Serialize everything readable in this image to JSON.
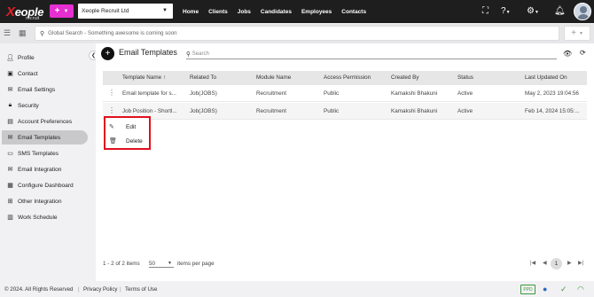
{
  "brand": {
    "logo_main": "Xeople",
    "logo_sub": "recruit",
    "color": "#e21f26"
  },
  "header": {
    "add_button": "+",
    "company": "Xeople Recruit Ltd",
    "nav": [
      "Home",
      "Clients",
      "Jobs",
      "Candidates",
      "Employees",
      "Contacts"
    ],
    "icons": [
      "fullscreen-icon",
      "help-icon",
      "settings-icon",
      "bell-icon",
      "avatar"
    ]
  },
  "search": {
    "placeholder": "Global Search - Something awesome is coming soon",
    "add_label": "+"
  },
  "sidebar": {
    "items": [
      {
        "label": "Profile",
        "icon": "person-icon"
      },
      {
        "label": "Contact",
        "icon": "contact-card-icon"
      },
      {
        "label": "Email Settings",
        "icon": "email-icon"
      },
      {
        "label": "Security",
        "icon": "lock-icon"
      },
      {
        "label": "Account Preferences",
        "icon": "account-icon"
      },
      {
        "label": "Email Templates",
        "icon": "email-open-icon",
        "active": true
      },
      {
        "label": "SMS Templates",
        "icon": "sms-icon"
      },
      {
        "label": "Email Integration",
        "icon": "email-integration-icon"
      },
      {
        "label": "Configure Dashboard",
        "icon": "dashboard-icon"
      },
      {
        "label": "Other Integration",
        "icon": "integration-icon"
      },
      {
        "label": "Work Schedule",
        "icon": "calendar-icon"
      }
    ]
  },
  "page": {
    "title": "Email Templates",
    "search_placeholder": "Search"
  },
  "table": {
    "columns": [
      "Template Name",
      "Related To",
      "Module Name",
      "Access Permission",
      "Created By",
      "Status",
      "Last Updated On"
    ],
    "sort_indicator": "↑",
    "rows": [
      [
        "Email template for s...",
        "Job(JOBS)",
        "Recruitment",
        "Public",
        "Kamakshi Bhakuni",
        "Active",
        "May 2, 2023 19:04:56"
      ],
      [
        "Job Position - Shortl...",
        "Job(JOBS)",
        "Recruitment",
        "Public",
        "Kamakshi Bhakuni",
        "Active",
        "Feb 14, 2024 15:05:..."
      ]
    ]
  },
  "context_menu": {
    "items": [
      {
        "label": "Edit",
        "icon": "pencil-icon"
      },
      {
        "label": "Delete",
        "icon": "trash-icon"
      }
    ],
    "highlight_color": "#e0101e"
  },
  "pager": {
    "range": "1 - 2 of 2 items",
    "page_size": "50",
    "per_page_label": "items per page",
    "current_page": "1"
  },
  "footer": {
    "copyright": "© 2024. All Rights Reserved",
    "privacy": "Privacy Policy",
    "terms": "Terms of Use",
    "ppd": "PPD"
  }
}
